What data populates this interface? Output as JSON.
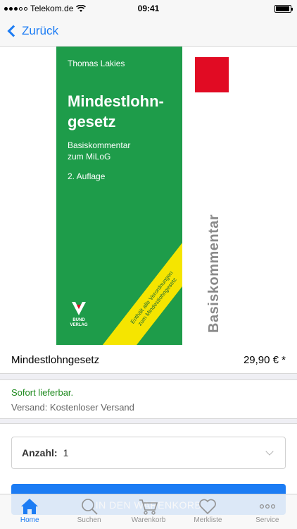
{
  "status_bar": {
    "carrier": "Telekom.de",
    "time": "09:41"
  },
  "nav": {
    "back_label": "Zurück"
  },
  "book_cover": {
    "author": "Thomas Lakies",
    "title_line1": "Mindestlohn-",
    "title_line2": "gesetz",
    "subtitle_line1": "Basiskommentar",
    "subtitle_line2": "zum MiLoG",
    "edition": "2. Auflage",
    "band_line1": "Enthält alle Verordnungen",
    "band_line2": "zum Mindestlohngesetz",
    "publisher_line1": "BUND",
    "publisher_line2": "VERLAG",
    "spine": "Basiskommentar",
    "colors": {
      "cover": "#1e9c4a",
      "accent": "#e10b23",
      "band": "#f5e500"
    }
  },
  "product": {
    "name": "Mindestlohngesetz",
    "price": "29,90 € *"
  },
  "availability": {
    "status": "Sofort lieferbar.",
    "shipping": "Versand: Kostenloser Versand"
  },
  "quantity": {
    "label": "Anzahl:",
    "value": "1"
  },
  "cart_button": {
    "label": "IN DEN WARENKORB"
  },
  "tabs": [
    {
      "label": "Home",
      "icon": "home-icon",
      "active": true
    },
    {
      "label": "Suchen",
      "icon": "search-icon",
      "active": false
    },
    {
      "label": "Warenkorb",
      "icon": "cart-icon",
      "active": false
    },
    {
      "label": "Merkliste",
      "icon": "heart-icon",
      "active": false
    },
    {
      "label": "Service",
      "icon": "more-icon",
      "active": false
    }
  ],
  "accent_color": "#1c7cf4"
}
